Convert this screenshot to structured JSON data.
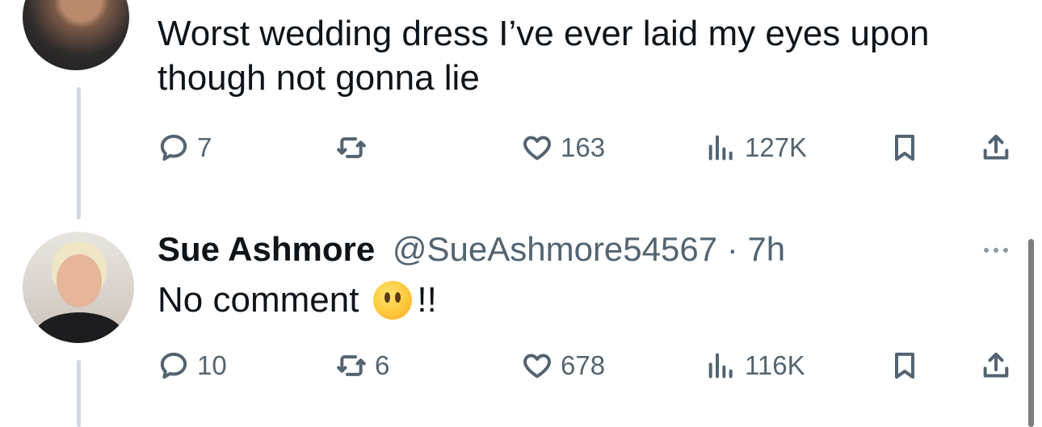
{
  "tweets": [
    {
      "text_line1": "Worst wedding dress I’ve ever laid my eyes upon",
      "text_line2": "though not gonna lie",
      "stats": {
        "replies": "7",
        "reposts": "",
        "likes": "163",
        "views": "127K"
      }
    },
    {
      "name": "Sue Ashmore",
      "handle": "@SueAshmore54567 · 7h",
      "text": "No comment",
      "text_suffix": "!!",
      "emoji": "no-mouth-face-emoji",
      "stats": {
        "replies": "10",
        "reposts": "6",
        "likes": "678",
        "views": "116K"
      }
    }
  ],
  "icons": {
    "reply": "reply-icon",
    "repost": "repost-icon",
    "like": "heart-icon",
    "views": "views-icon",
    "bookmark": "bookmark-icon",
    "share": "share-icon",
    "more": "more-icon"
  },
  "colors": {
    "text": "#0f1419",
    "secondary": "#536471",
    "thread_line": "#cfd9de"
  }
}
